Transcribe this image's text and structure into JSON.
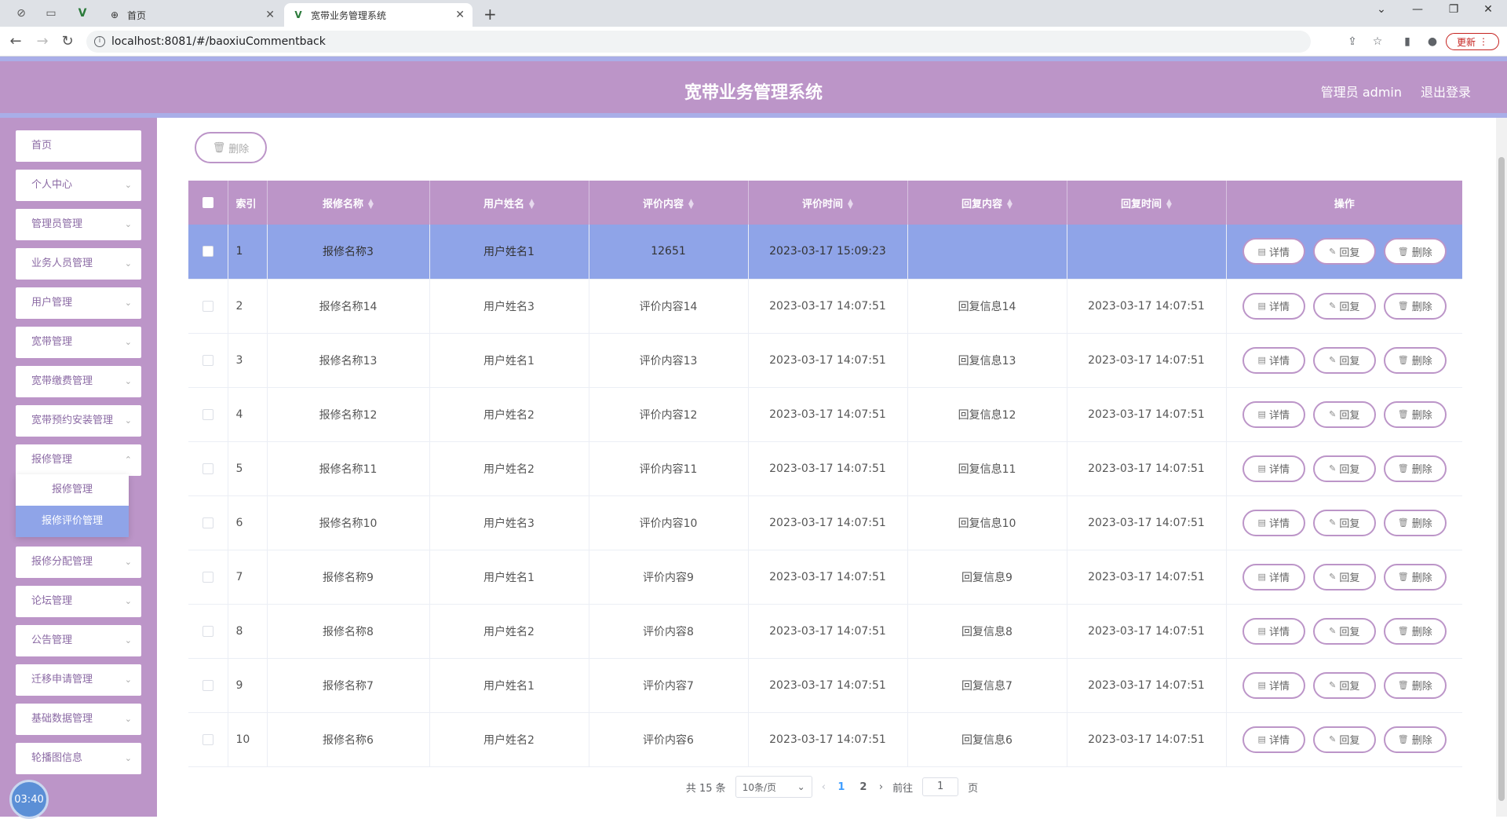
{
  "browser": {
    "tabs": [
      {
        "title": "首页",
        "active": false
      },
      {
        "title": "宽带业务管理系统",
        "active": true
      }
    ],
    "url": "localhost:8081/#/baoxiuCommentback",
    "update_label": "更新"
  },
  "header": {
    "title": "宽带业务管理系统",
    "user": "管理员 admin",
    "logout": "退出登录"
  },
  "sidebar": {
    "items": [
      {
        "label": "首页"
      },
      {
        "label": "个人中心"
      },
      {
        "label": "管理员管理"
      },
      {
        "label": "业务人员管理"
      },
      {
        "label": "用户管理"
      },
      {
        "label": "宽带管理"
      },
      {
        "label": "宽带缴费管理"
      },
      {
        "label": "宽带预约安装管理"
      },
      {
        "label": "报修管理"
      },
      {
        "label": "报修分配管理"
      },
      {
        "label": "论坛管理"
      },
      {
        "label": "公告管理"
      },
      {
        "label": "迁移申请管理"
      },
      {
        "label": "基础数据管理"
      },
      {
        "label": "轮播图信息"
      }
    ],
    "submenu": [
      {
        "label": "报修管理",
        "active": false
      },
      {
        "label": "报修评价管理",
        "active": true
      }
    ],
    "clock": "03:40"
  },
  "toolbar": {
    "delete_label": "删除"
  },
  "table": {
    "columns": [
      "索引",
      "报修名称",
      "用户姓名",
      "评价内容",
      "评价时间",
      "回复内容",
      "回复时间",
      "操作"
    ],
    "rows": [
      {
        "index": "1",
        "name": "报修名称3",
        "user": "用户姓名1",
        "content": "12651",
        "time": "2023-03-17 15:09:23",
        "reply": "",
        "reply_time": "",
        "selected": true
      },
      {
        "index": "2",
        "name": "报修名称14",
        "user": "用户姓名3",
        "content": "评价内容14",
        "time": "2023-03-17 14:07:51",
        "reply": "回复信息14",
        "reply_time": "2023-03-17 14:07:51"
      },
      {
        "index": "3",
        "name": "报修名称13",
        "user": "用户姓名1",
        "content": "评价内容13",
        "time": "2023-03-17 14:07:51",
        "reply": "回复信息13",
        "reply_time": "2023-03-17 14:07:51"
      },
      {
        "index": "4",
        "name": "报修名称12",
        "user": "用户姓名2",
        "content": "评价内容12",
        "time": "2023-03-17 14:07:51",
        "reply": "回复信息12",
        "reply_time": "2023-03-17 14:07:51"
      },
      {
        "index": "5",
        "name": "报修名称11",
        "user": "用户姓名2",
        "content": "评价内容11",
        "time": "2023-03-17 14:07:51",
        "reply": "回复信息11",
        "reply_time": "2023-03-17 14:07:51"
      },
      {
        "index": "6",
        "name": "报修名称10",
        "user": "用户姓名3",
        "content": "评价内容10",
        "time": "2023-03-17 14:07:51",
        "reply": "回复信息10",
        "reply_time": "2023-03-17 14:07:51"
      },
      {
        "index": "7",
        "name": "报修名称9",
        "user": "用户姓名1",
        "content": "评价内容9",
        "time": "2023-03-17 14:07:51",
        "reply": "回复信息9",
        "reply_time": "2023-03-17 14:07:51"
      },
      {
        "index": "8",
        "name": "报修名称8",
        "user": "用户姓名2",
        "content": "评价内容8",
        "time": "2023-03-17 14:07:51",
        "reply": "回复信息8",
        "reply_time": "2023-03-17 14:07:51"
      },
      {
        "index": "9",
        "name": "报修名称7",
        "user": "用户姓名1",
        "content": "评价内容7",
        "time": "2023-03-17 14:07:51",
        "reply": "回复信息7",
        "reply_time": "2023-03-17 14:07:51"
      },
      {
        "index": "10",
        "name": "报修名称6",
        "user": "用户姓名2",
        "content": "评价内容6",
        "time": "2023-03-17 14:07:51",
        "reply": "回复信息6",
        "reply_time": "2023-03-17 14:07:51"
      }
    ],
    "actions": {
      "detail": "详情",
      "reply": "回复",
      "delete": "删除"
    }
  },
  "pagination": {
    "total": "共 15 条",
    "page_size": "10条/页",
    "pages": [
      "1",
      "2"
    ],
    "current": "1",
    "goto_prefix": "前往",
    "goto_value": "1",
    "goto_suffix": "页"
  }
}
